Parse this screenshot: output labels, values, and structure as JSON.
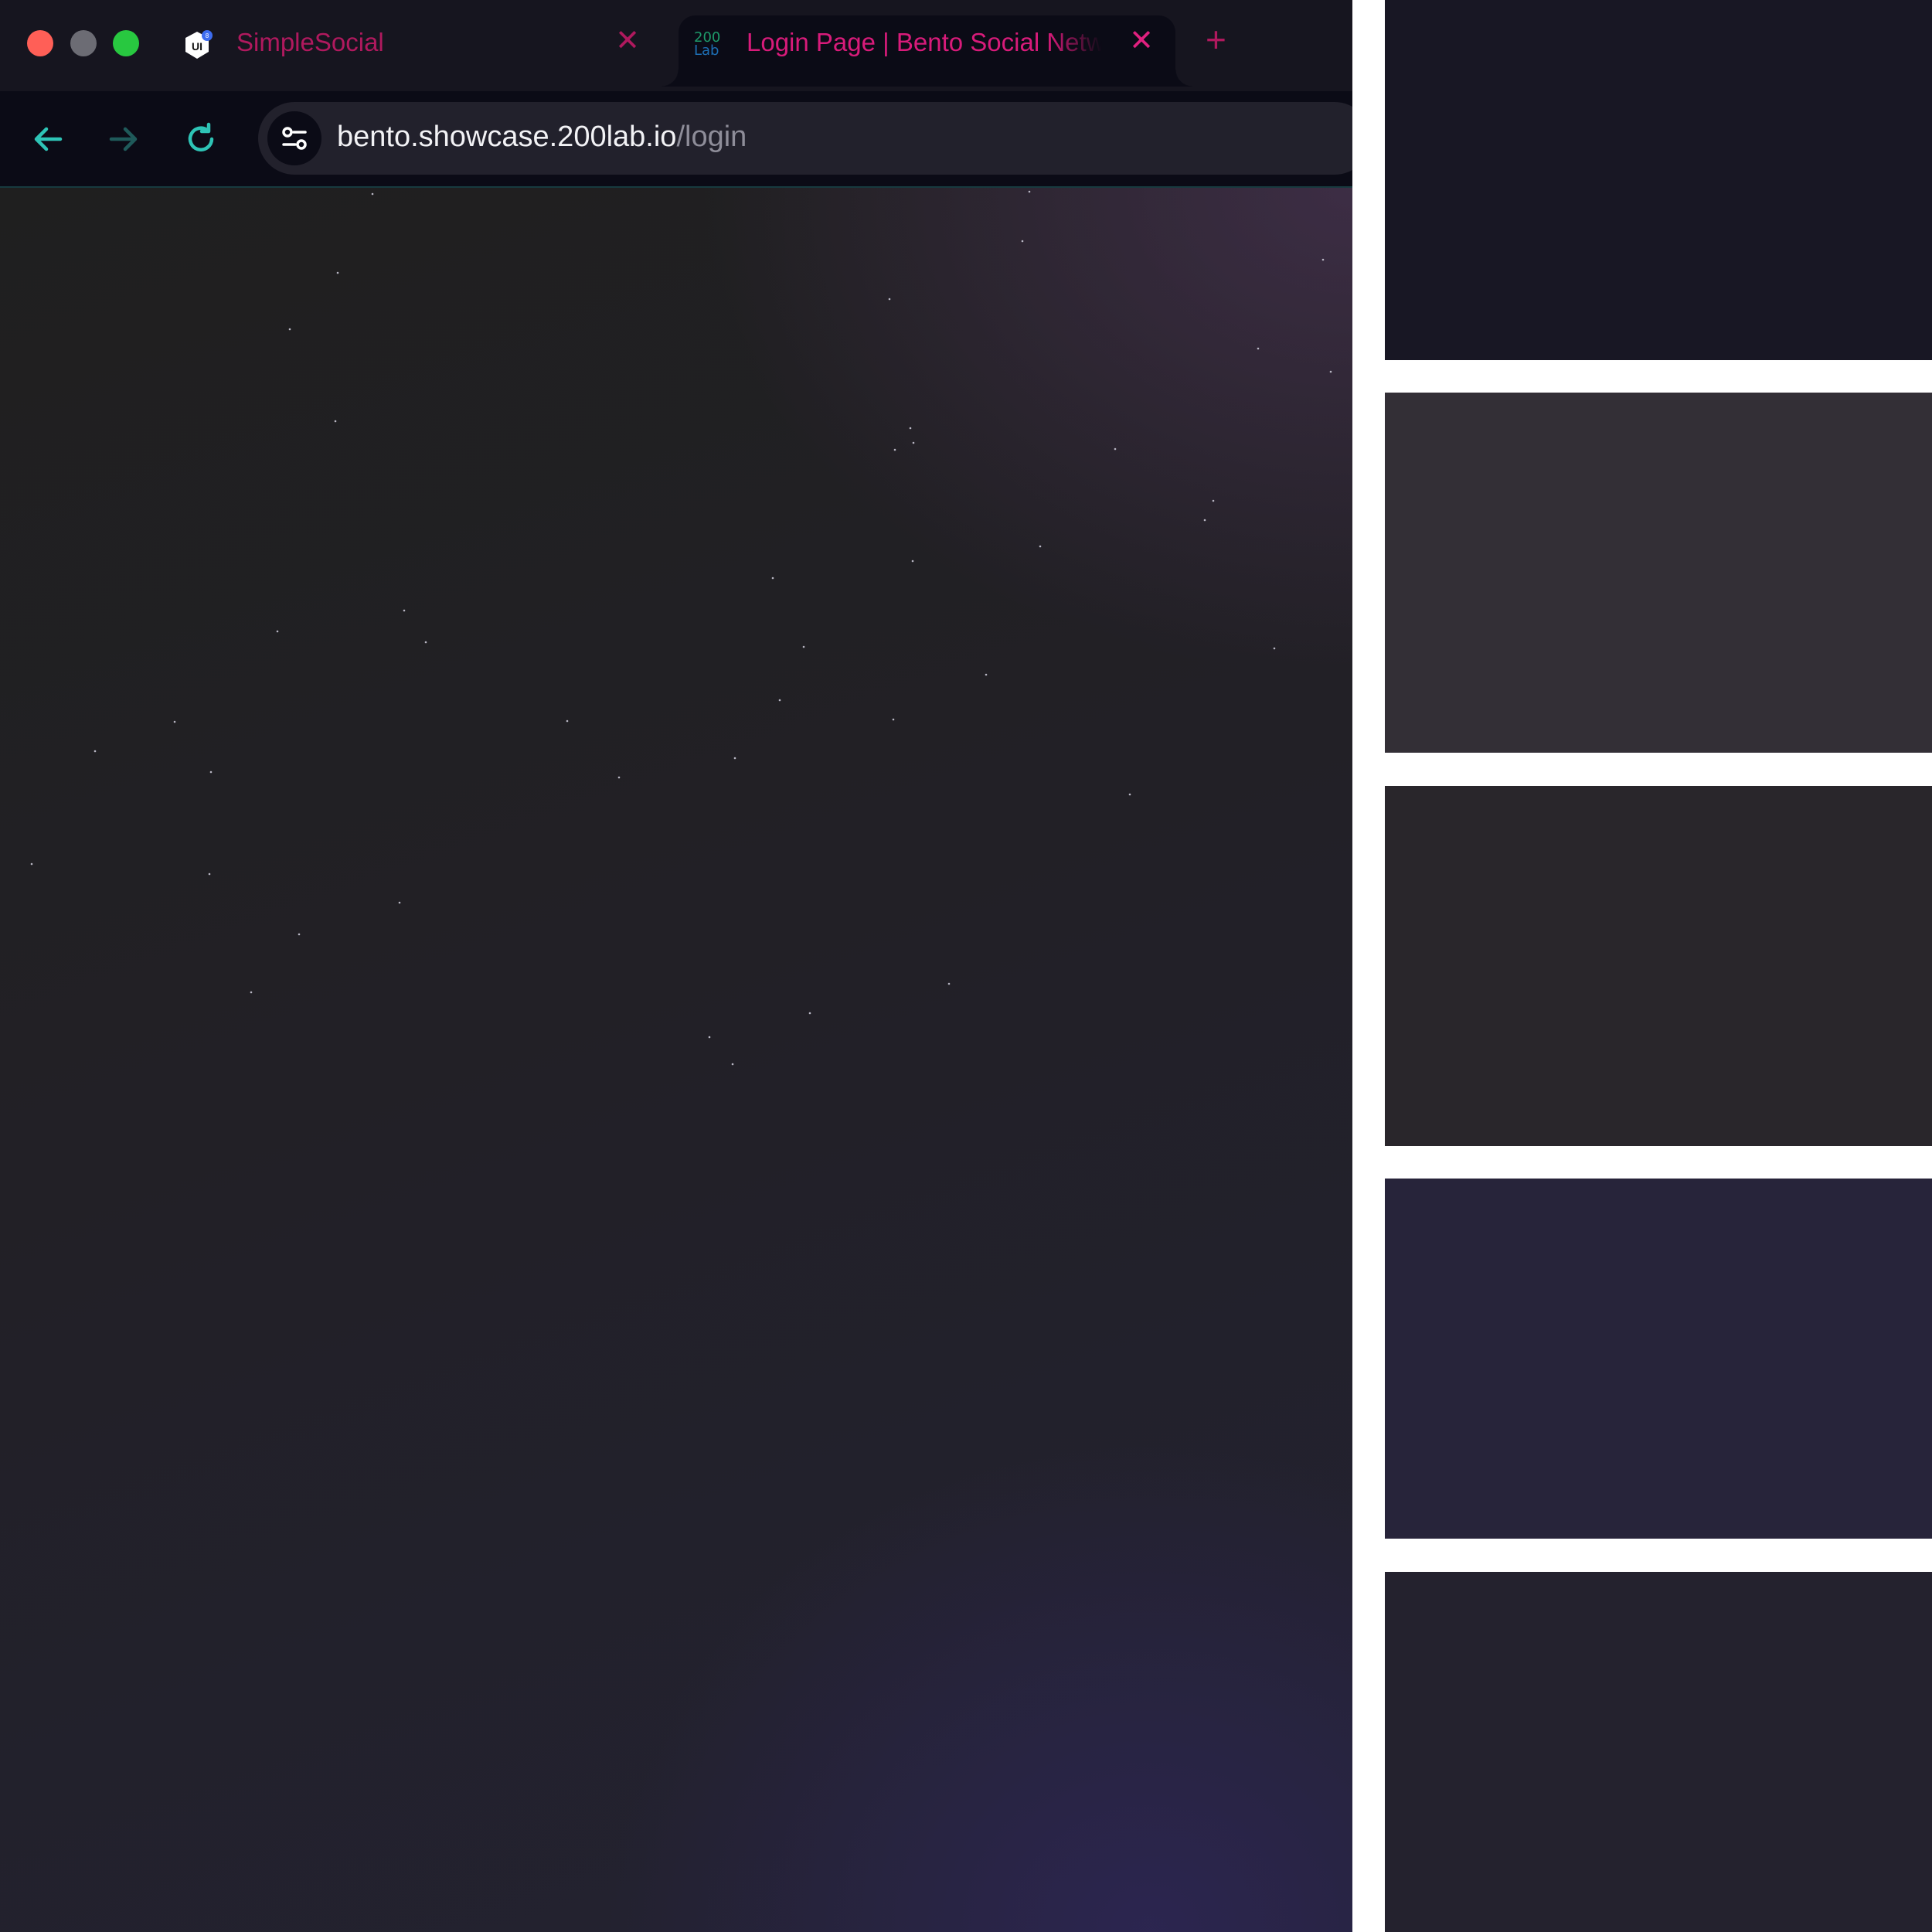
{
  "tabs": [
    {
      "title": "SimpleSocial",
      "favicon": "ui8-icon",
      "active": false
    },
    {
      "title": "Login Page | Bento Social Network",
      "favicon": "200lab-icon",
      "active": true
    }
  ],
  "favicon_200lab": {
    "line1": "200",
    "line2": "Lab"
  },
  "favicon_ui8": {
    "text": "UI",
    "badge": "8"
  },
  "tab_close_glyph": "✕",
  "new_tab_glyph": "+",
  "address_bar": {
    "host": "bento.showcase.200lab.io",
    "path": "/login"
  },
  "colors": {
    "accent_pink": "#d81b7a",
    "accent_teal": "#2ec4b6",
    "panel_1": "#181724",
    "panel_2": "#332f36",
    "panel_3": "#29262b",
    "panel_4": "#27243a",
    "panel_5": "#24222e"
  }
}
